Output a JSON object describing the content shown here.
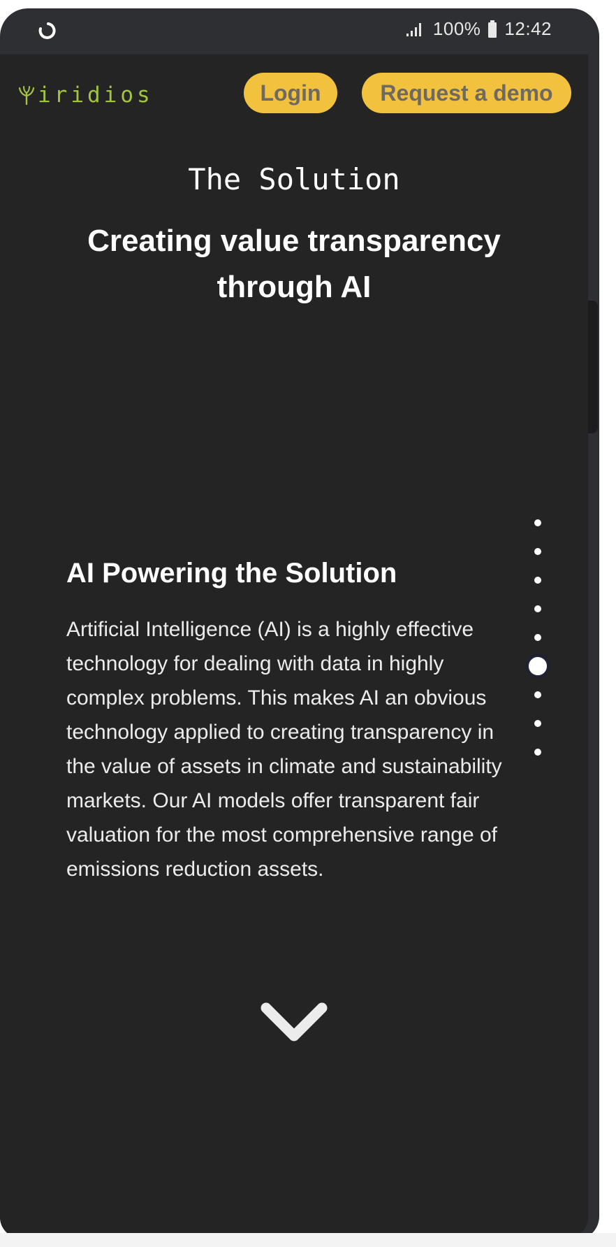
{
  "status_bar": {
    "left_icon": "loading-icon",
    "battery": "100%",
    "time": "12:42",
    "icons": [
      "signal-icon",
      "battery-icon"
    ]
  },
  "header": {
    "logo_text": "iridios",
    "logo_icon": "sprout-icon",
    "login_label": "Login",
    "demo_label": "Request a demo"
  },
  "hero": {
    "kicker": "The Solution",
    "title": "Creating value transparency through AI"
  },
  "content": {
    "heading": "AI Powering the Solution",
    "body": "Artificial Intelligence (AI) is a highly effective technology for dealing with data in highly complex problems. This makes AI an obvious technology applied to creating transparency in the value of assets in climate and sustainability markets. Our AI models offer transparent fair valuation for the most comprehensive range of emissions reduction assets."
  },
  "pager": {
    "count": 9,
    "active_index": 5
  },
  "scroll_icon": "chevron-down-icon",
  "colors": {
    "background": "#242424",
    "accent": "#f2c13d",
    "logo": "#a4c441",
    "button_text": "#6e6a61",
    "text": "#ffffff"
  }
}
